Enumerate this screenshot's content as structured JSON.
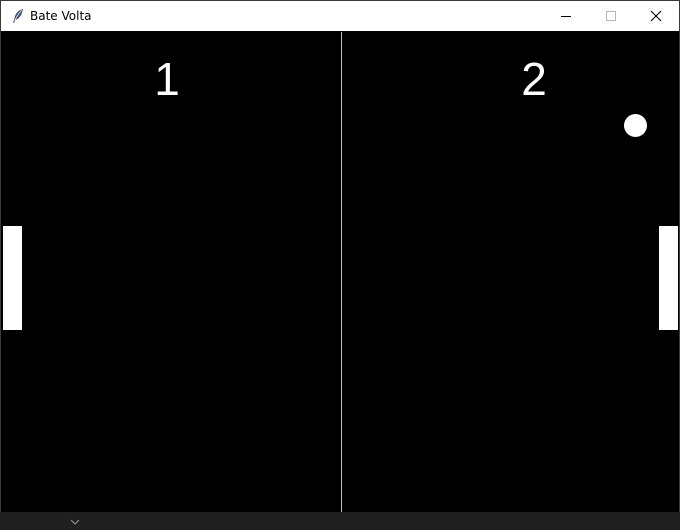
{
  "window": {
    "title": "Bate Volta",
    "icon": "feather-icon"
  },
  "controls": {
    "minimize_icon": "minimize-icon",
    "maximize_icon": "maximize-icon",
    "close_icon": "close-icon"
  },
  "game": {
    "score_left": "1",
    "score_right": "2",
    "colors": {
      "background": "#000000",
      "foreground": "#ffffff",
      "center_line": "#bdbdbd"
    }
  }
}
